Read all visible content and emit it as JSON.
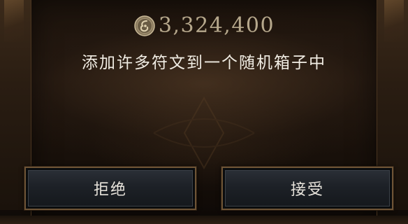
{
  "price": {
    "currency_icon": "gold-coin-icon",
    "amount": "3,324,400"
  },
  "description": "添加许多符文到一个随机箱子中",
  "buttons": {
    "decline_label": "拒绝",
    "accept_label": "接受"
  },
  "colors": {
    "price_text": "#b6a88c",
    "text": "#f1ede4",
    "button_border": "#6e5436",
    "button_fill": "#1d2127"
  }
}
